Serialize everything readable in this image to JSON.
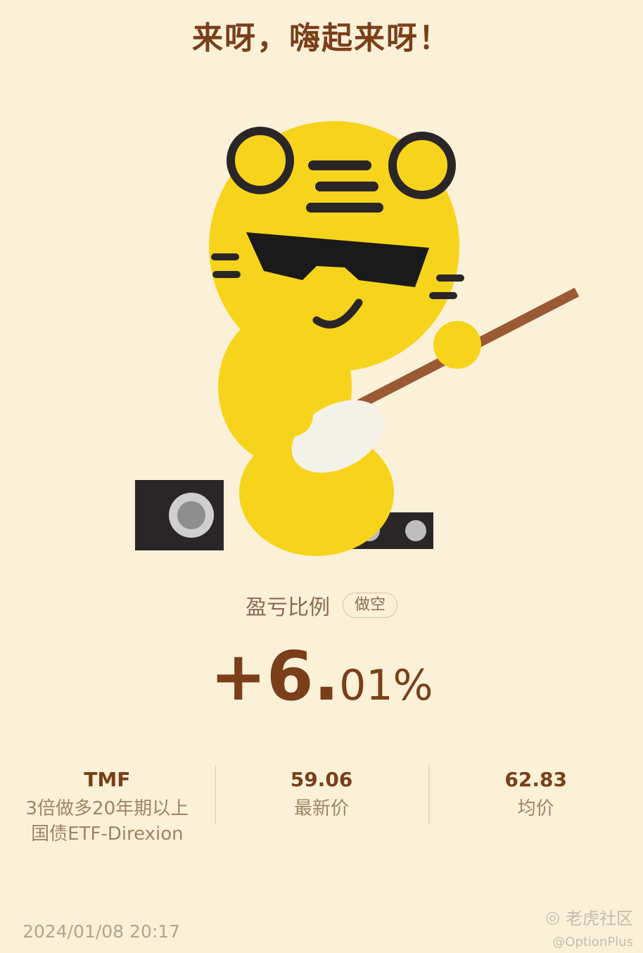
{
  "headline": "来呀，嗨起来呀！",
  "ratio": {
    "label": "盈亏比例",
    "badge": "做空"
  },
  "pnl": {
    "main": "+6.",
    "decimal": "01%"
  },
  "stats": [
    {
      "value": "TMF",
      "label": "3倍做多20年期以上国债ETF-Direxion"
    },
    {
      "value": "59.06",
      "label": "最新价"
    },
    {
      "value": "62.83",
      "label": "均价"
    }
  ],
  "timestamp": "2024/01/08 20:17",
  "watermark": {
    "brand": "老虎社区",
    "handle": "@OptionPlus"
  },
  "colors": {
    "background": "#fbf1d8",
    "accent": "#7a3f1a",
    "tiger": "#f7d41c"
  }
}
